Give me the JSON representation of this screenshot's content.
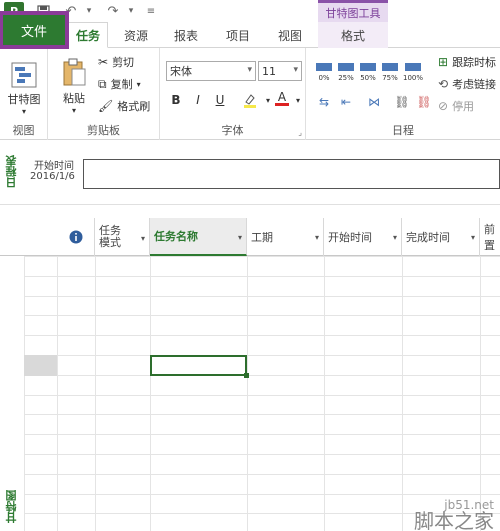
{
  "app": {
    "logo": "P"
  },
  "quick_access": {
    "save_icon": "save-icon",
    "undo_icon": "undo-icon",
    "redo_icon": "redo-icon",
    "customize_icon": "customize-icon"
  },
  "context_tab_header": "甘特图工具",
  "tabs": {
    "file": "文件",
    "task": "任务",
    "resource": "资源",
    "report": "报表",
    "project": "项目",
    "view": "视图",
    "format": "格式"
  },
  "ribbon": {
    "view_group": {
      "gantt_label": "甘特图",
      "group_label": "视图"
    },
    "clipboard_group": {
      "paste_label": "粘贴",
      "cut_label": "剪切",
      "copy_label": "复制",
      "format_painter_label": "格式刷",
      "group_label": "剪贴板"
    },
    "font_group": {
      "font_name": "宋体",
      "font_size": "11",
      "bold": "B",
      "italic": "I",
      "underline": "U",
      "font_color_letter": "A",
      "group_label": "字体"
    },
    "schedule_group": {
      "pct_buttons": [
        "0%",
        "25%",
        "50%",
        "75%",
        "100%"
      ],
      "track_label": "跟踪时标",
      "respect_links_label": "考虑链接",
      "inactivate_label": "停用",
      "group_label": "日程"
    }
  },
  "timeline": {
    "side_label": "日程表",
    "start_caption": "开始时间",
    "start_date": "2016/1/6"
  },
  "grid": {
    "side_label": "甘特图",
    "columns": [
      "任务模式",
      "任务名称",
      "工期",
      "开始时间",
      "完成时间",
      "前置"
    ],
    "mode_line1": "任务",
    "mode_line2": "模式",
    "info_icon": "info-icon"
  },
  "watermark": {
    "line1": "jb51.net",
    "line2": "脚本之家"
  },
  "colors": {
    "project_green": "#2d7a31",
    "highlight_purple": "#8a3b98",
    "context_purple": "#7b3f99"
  }
}
